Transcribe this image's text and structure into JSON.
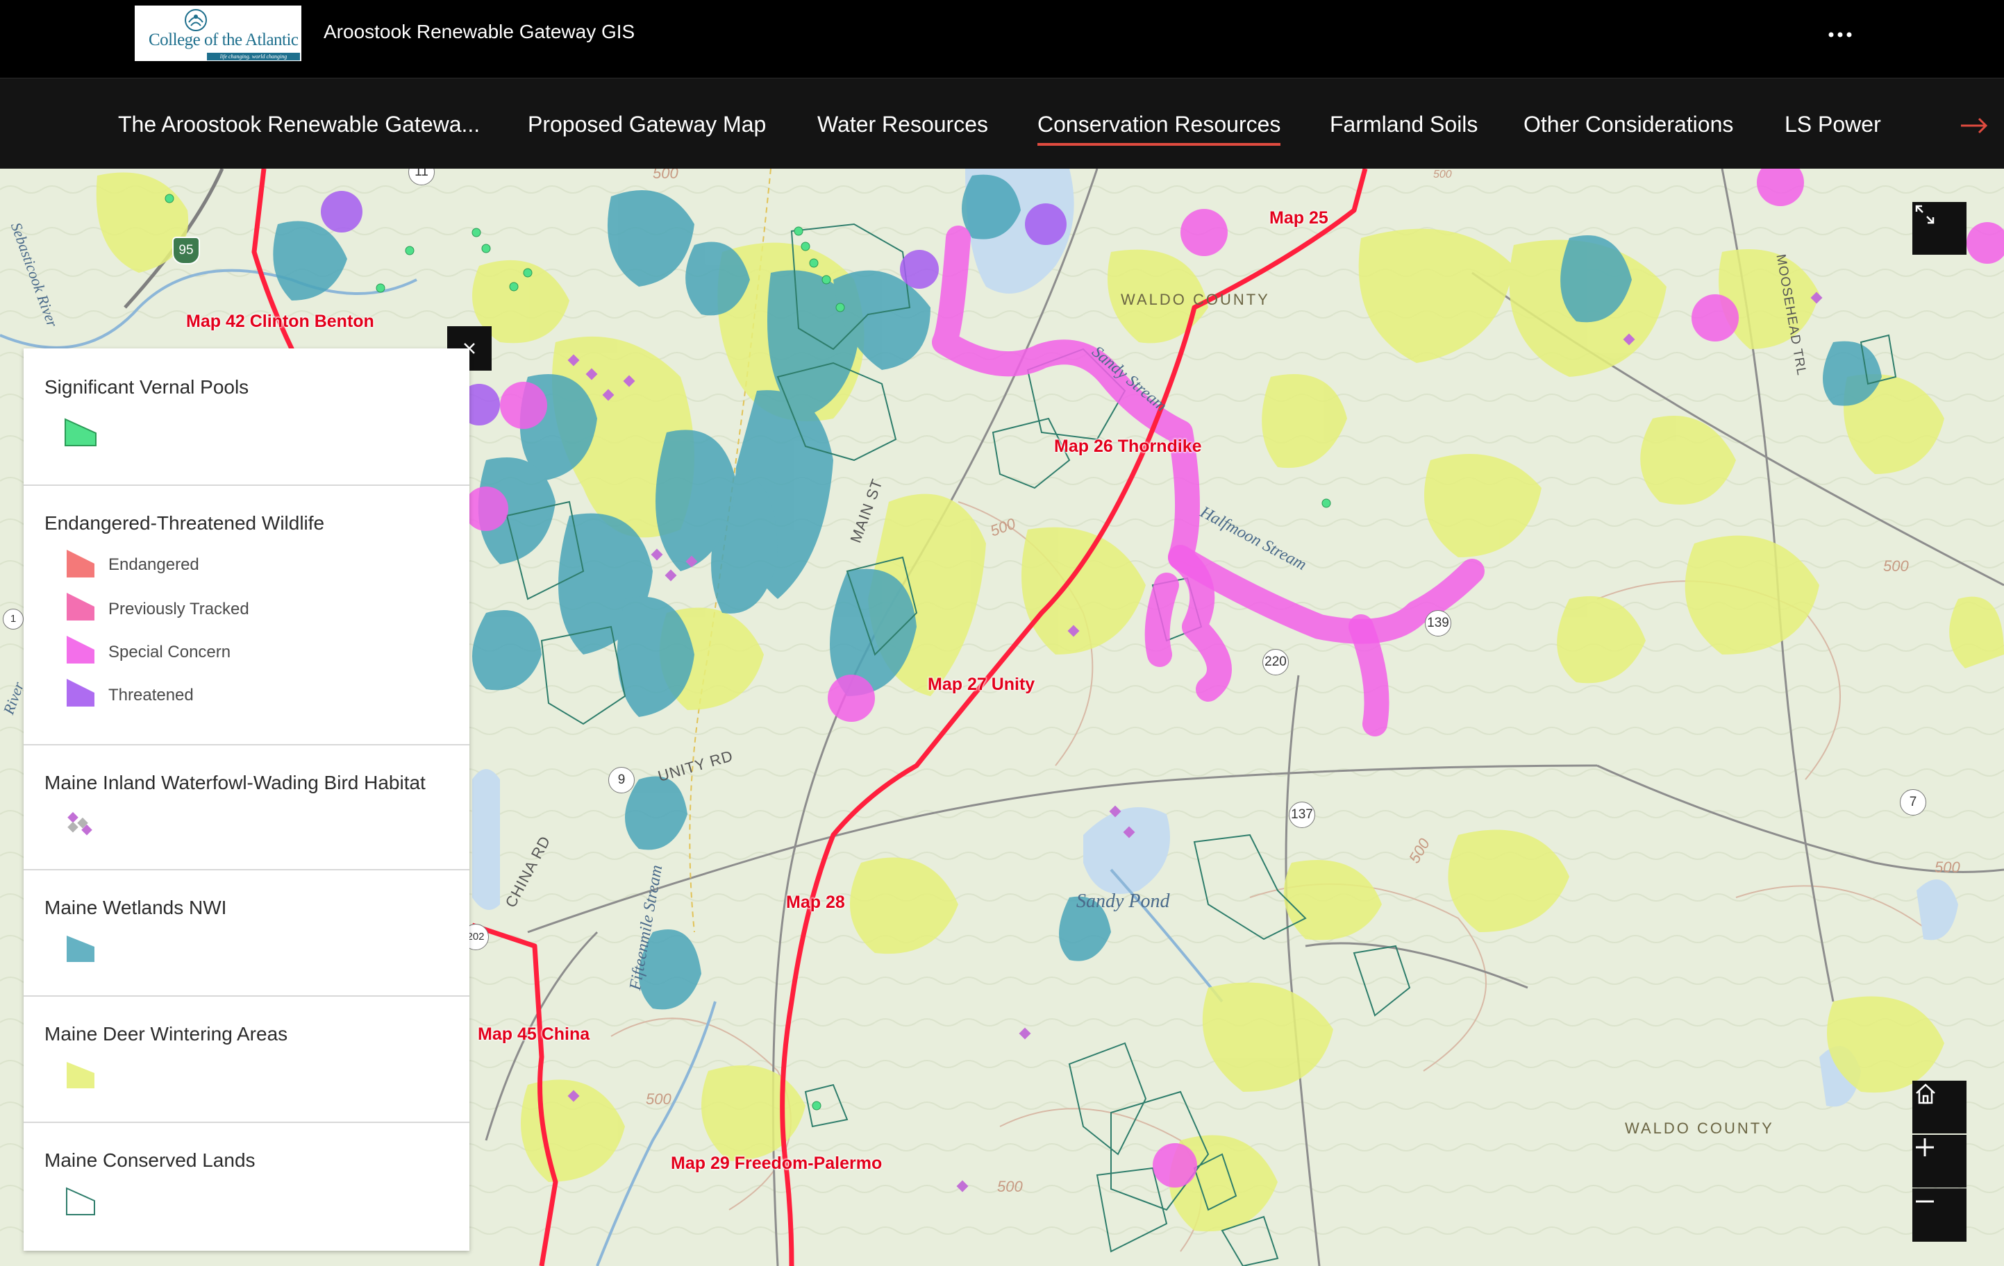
{
  "header": {
    "logo_name": "College of the Atlantic",
    "logo_tagline": "life changing. world changing",
    "app_title": "Aroostook Renewable Gateway GIS",
    "more_icon": "more-dots-icon"
  },
  "nav": {
    "tabs": [
      {
        "label": "The Aroostook Renewable Gatewa...",
        "active": false
      },
      {
        "label": "Proposed Gateway Map",
        "active": false
      },
      {
        "label": "Water Resources",
        "active": false
      },
      {
        "label": "Conservation Resources",
        "active": true
      },
      {
        "label": "Farmland Soils",
        "active": false
      },
      {
        "label": "Other Considerations",
        "active": false
      },
      {
        "label": "LS Power",
        "active": false
      }
    ],
    "next_icon": "arrow-right-icon",
    "accent_color": "#e04b3f"
  },
  "legend": {
    "sections": [
      {
        "title": "Significant Vernal Pools",
        "items": [
          {
            "label": "",
            "color": "#4fe08a"
          }
        ]
      },
      {
        "title": "Endangered-Threatened Wildlife",
        "items": [
          {
            "label": "Endangered",
            "color": "#f36a6a"
          },
          {
            "label": "Previously Tracked",
            "color": "#f25fa8"
          },
          {
            "label": "Special Concern",
            "color": "#f25fe8"
          },
          {
            "label": "Threatened",
            "color": "#a55cf0"
          }
        ]
      },
      {
        "title": "Maine Inland Waterfowl-Wading Bird Habitat",
        "items": [
          {
            "label": "",
            "color": "#c26fd6"
          }
        ]
      },
      {
        "title": "Maine Wetlands NWI",
        "items": [
          {
            "label": "",
            "color": "#4aa5b8"
          }
        ]
      },
      {
        "title": "Maine Deer Wintering Areas",
        "items": [
          {
            "label": "",
            "color": "#e5f07a"
          }
        ]
      },
      {
        "title": "Maine Conserved Lands",
        "items": [
          {
            "label": "",
            "color": "#2e7d6b"
          }
        ]
      }
    ],
    "close_icon": "close-icon"
  },
  "map": {
    "segment_labels": [
      "Map 25",
      "Map 42 Clinton Benton",
      "Map 26 Thorndike",
      "Map 27 Unity",
      "Map 28",
      "Map 45 China",
      "Map 29 Freedom-Palermo"
    ],
    "county_labels": [
      "WALDO COUNTY",
      "WALDO COUNTY"
    ],
    "water_labels": [
      "Sandy Pond",
      "Sandy Stream",
      "Halfmoon Stream",
      "Fifteenmile Stream",
      "Sebasticook River",
      "River"
    ],
    "road_labels": [
      "MAIN ST",
      "UNITY RD",
      "CHINA RD",
      "MOOSEHEAD TRL"
    ],
    "route_shields": [
      "95",
      "11",
      "9",
      "202",
      "220",
      "139",
      "137",
      "7",
      "1"
    ],
    "elevation_labels": [
      "500",
      "500",
      "500",
      "500",
      "500",
      "500",
      "500",
      "500"
    ],
    "controls": {
      "expand_icon": "expand-icon",
      "home_icon": "home-icon",
      "zoom_in_icon": "zoom-in-icon",
      "zoom_out_icon": "zoom-out-icon"
    },
    "colors": {
      "gateway_line": "#ff1f3d",
      "wetlands": "#4aa5b8",
      "deer_wintering": "#e5f07a",
      "wildlife_special_concern": "#f25fe8",
      "wildlife_threatened": "#a55cf0",
      "conserved_lands_outline": "#2e7d6b",
      "vernal_pools": "#4fe08a"
    }
  }
}
